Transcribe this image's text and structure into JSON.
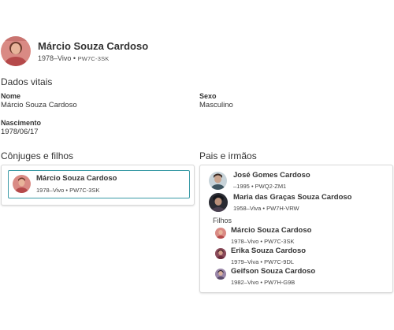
{
  "person": {
    "name": "Márcio Souza Cardoso",
    "lifespan": "1978–Vivo",
    "separator": "•",
    "id": "PW7C-3SK",
    "avatar_icon": "person-photo-avatar"
  },
  "vitals": {
    "title": "Dados vitais",
    "name_label": "Nome",
    "name_value": "Márcio Souza Cardoso",
    "sex_label": "Sexo",
    "sex_value": "Masculino",
    "birth_label": "Nascimento",
    "birth_value": "1978/06/17"
  },
  "spouses_children": {
    "title": "Cônjuges e filhos",
    "person": {
      "name": "Márcio Souza Cardoso",
      "meta": "1978–Vivo • PW7C-3SK"
    }
  },
  "parents_siblings": {
    "title": "Pais e irmãos",
    "parents": [
      {
        "name": "José Gomes Cardoso",
        "meta": "–1995 • PWQ2-ZM1"
      },
      {
        "name": "Maria das Graças Souza Cardoso",
        "meta": "1958–Viva • PW7H-VRW"
      }
    ],
    "children_label": "Filhos",
    "children": [
      {
        "name": "Márcio Souza Cardoso",
        "meta": "1978–Vivo • PW7C-3SK"
      },
      {
        "name": "Erika Souza Cardoso",
        "meta": "1979–Viva • PW7C-9DL"
      },
      {
        "name": "Geifson Souza Cardoso",
        "meta": "1982–Vivo • PW7H-G9B"
      }
    ]
  },
  "colors": {
    "accent_border": "#3a9aa6",
    "text": "#333333"
  }
}
